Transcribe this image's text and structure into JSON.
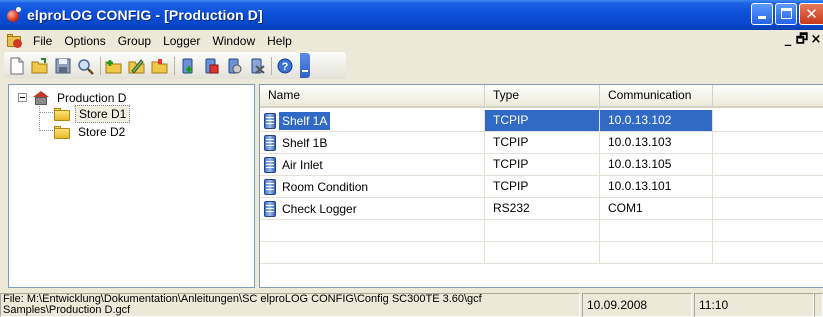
{
  "window": {
    "title": "elproLOG CONFIG - [Production D]",
    "accent": "#0a4fd9",
    "controls": [
      "minimize-icon",
      "maximize-icon",
      "close-icon"
    ]
  },
  "menu": {
    "items": [
      "File",
      "Options",
      "Group",
      "Logger",
      "Window",
      "Help"
    ],
    "mdi_controls": [
      "_",
      "🗗",
      "×"
    ]
  },
  "toolbar": {
    "icons": [
      "new-file-icon",
      "open-icon",
      "save-icon",
      "search-icon",
      "add-group-icon",
      "edit-group-icon",
      "delete-group-icon",
      "add-logger-icon",
      "edit-logger-icon",
      "logger-config-icon",
      "delete-logger-icon",
      "help-icon"
    ]
  },
  "tree": {
    "root": "Production D",
    "children": [
      "Store D1",
      "Store D2"
    ],
    "selected": "Store D1"
  },
  "list": {
    "columns": [
      "Name",
      "Type",
      "Communication"
    ],
    "rows": [
      {
        "name": "Shelf 1A",
        "type": "TCPIP",
        "comm": "10.0.13.102"
      },
      {
        "name": "Shelf 1B",
        "type": "TCPIP",
        "comm": "10.0.13.103"
      },
      {
        "name": "Air Inlet",
        "type": "TCPIP",
        "comm": "10.0.13.105"
      },
      {
        "name": "Room Condition",
        "type": "TCPIP",
        "comm": "10.0.13.101"
      },
      {
        "name": "Check Logger",
        "type": "RS232",
        "comm": "COM1"
      }
    ],
    "selected_index": 0,
    "selection_color": "#316ac5"
  },
  "status": {
    "file_line1": "File:  M:\\Entwicklung\\Dokumentation\\Anleitungen\\SC  elproLOG  CONFIG\\Config SC300TE  3.60\\gcf",
    "file_line2": "Samples\\Production D.gcf",
    "date": "10.09.2008",
    "time": "11:10"
  }
}
